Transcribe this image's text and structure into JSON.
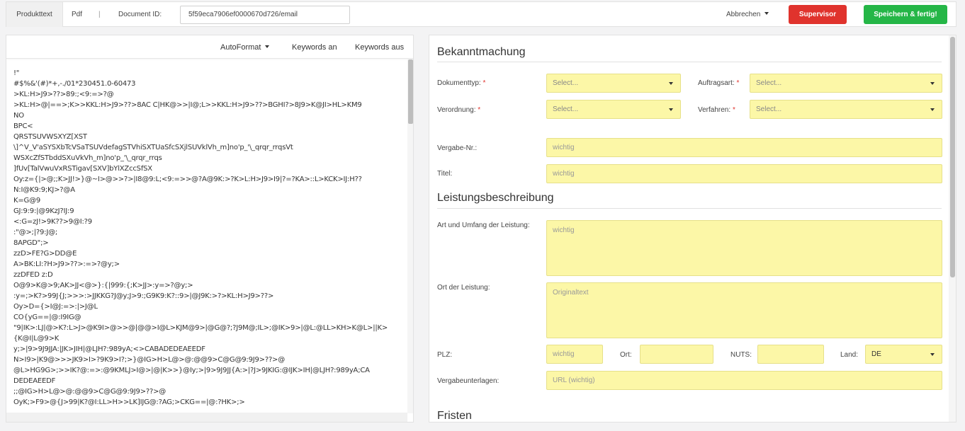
{
  "topbar": {
    "tab_produkttext": "Produkttext",
    "tab_pdf": "Pdf",
    "separator": "|",
    "document_id_label": "Document ID:",
    "document_id_value": "5f59eca7906ef0000670d726/email",
    "abbrechen": "Abbrechen",
    "supervisor": "Supervisor",
    "save": "Speichern & fertig!"
  },
  "left": {
    "toolbar": {
      "autoformat": "AutoFormat",
      "keywords_on": "Keywords an",
      "keywords_off": "Keywords aus"
    },
    "lines": [
      "!\"",
      "#$%&'(#)*+,-./01*230451.0-60473",
      ">KL:H>J9>??>89:;<9:=>?@",
      ">KL:H>@|==>;K>>KKL:H>J9>??>8AC C|HK@>>|I@;L>>KKL:H>J9>??>BGHI?>8J9>K@JI>HL>KM9",
      "NO",
      "BPC<",
      "QRSTSUVWSXYZ[XST",
      "\\]^V_V'aSYSXbTcVSaTSUVdefagSTVhiSXTUaSfcSXjlSUVklVh_m]no'p_'\\_qrqr_rrqsVt",
      "WSXcZfSTbddSXuVkVh_m]no'p_'\\_qrqr_rrqs",
      "]fUv[TalVwuVxRSTigav[SXV]bYlXZccSfSX",
      "Oy:z={|>@;;K>JJ!>}@~I>@>>?>|I8@9:L;<9:=>>@?A@9K:>?K>L:H>J9>I9|?=?KA>::L>KCK>IJ:H??",
      "N:I@K9:9;KJ>?@A",
      "K=G@9",
      "GJ:9:9:|@9KzJ?IJ:9",
      "<:G=zJ!>9K??>9@I:?9",
      ":\"@>;|?9:J@;",
      "8APGD\";>",
      "zzD>FE?G>DD@E",
      "A>BK:LI:?H>J9>??>:=>?@y;>",
      "zzDFED z:D",
      "O@9>K@>9;AK>JJ<@>}:{|999:{;K>JJ>:y=>?@y;>",
      ":y=;>K?>99J{J;>>>:>JJKKG?J@y;J>9:;G9K9:K?::9>|@J9K:>?>KL:H>J9>??>",
      "Oy>D={>I@J:=>:|>J@L",
      "CO{yG==|@:I9IG@",
      "\"9|IK>:LJ|@>K?:L>J>@K9I>@>>@|@@>I@L>KJM@9>|@G@?;?J9M@;IL>;@IK>9>|@L:@LL>KH>K@L>||K>",
      "{K@I|L@9>K",
      "y;>|9>9J9JJA:|JK>JIH|@LJH?:989yA;<>CABADEDEAEEDF",
      "N>I9>|K9@>>>JK9>I>?9K9>I?;>}@IG>H>L@>@:@@9>C@G@9:9J9>??>@",
      "@L>HG9G>;>>IK?@:=>:@9KMLJ>I@>|@|K>>}@Iy;>|9>9J9JJ{A:>|?J>9JKIG:@IJK>IH|@LJH?:989yA;CA",
      "DEDEAEEDF",
      ";;@IG>H>L@>@:@@9>C@G@9:9J9>??>@",
      "OyK;>F9>@{J>99|K?@I:LL>H>>LK]IJG@:?AG;>CKG==|@:?HK>;>"
    ]
  },
  "right": {
    "section1_title": "Bekanntmachung",
    "dokumenttyp_label": "Dokumenttyp:",
    "dokumenttyp_value": "Select...",
    "auftragsart_label": "Auftragsart:",
    "auftragsart_value": "Select...",
    "verordnung_label": "Verordnung:",
    "verordnung_value": "Select...",
    "verfahren_label": "Verfahren:",
    "verfahren_value": "Select...",
    "required_mark": "*",
    "vergabe_nr_label": "Vergabe-Nr.:",
    "vergabe_nr_placeholder": "wichtig",
    "titel_label": "Titel:",
    "titel_placeholder": "wichtig",
    "section2_title": "Leistungsbeschreibung",
    "art_umfang_label": "Art und Umfang der Leistung:",
    "art_umfang_placeholder": "wichtig",
    "ort_leistung_label": "Ort der Leistung:",
    "ort_leistung_placeholder": "Originaltext",
    "plz_label": "PLZ:",
    "plz_placeholder": "wichtig",
    "ort_label": "Ort:",
    "ort_value": "",
    "nuts_label": "NUTS:",
    "nuts_value": "",
    "land_label": "Land:",
    "land_value": "DE",
    "vergabeunterlagen_label": "Vergabeunterlagen:",
    "vergabeunterlagen_placeholder": "URL (wichtig)",
    "section3_title": "Fristen"
  }
}
